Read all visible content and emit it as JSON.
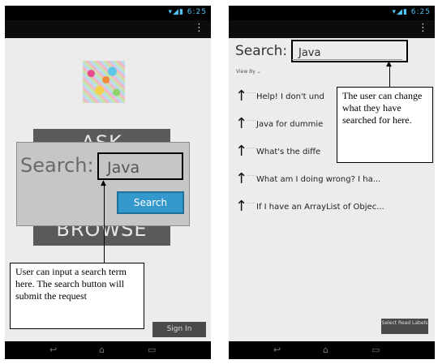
{
  "phone1": {
    "status_time": "6:25",
    "logo_icon": "app-logo-icon",
    "ask_label": "ASK",
    "browse_label": "BROWSE",
    "dialog": {
      "label": "Search:",
      "input_value": "Java",
      "button_label": "Search"
    },
    "signin_label": "Sign In"
  },
  "phone2": {
    "status_time": "6:25",
    "search_label": "Search:",
    "search_value": "Java",
    "viewby_label": "View By",
    "results": [
      {
        "title": "Help! I don't und"
      },
      {
        "title": "Java for dummie"
      },
      {
        "title": "What's the diffe"
      },
      {
        "title": "What am I doing wrong? I ha..."
      },
      {
        "title": "If I have an ArrayList of Objec..."
      }
    ],
    "select_read_label": "Select Read Labels"
  },
  "callouts": {
    "left": "User can input a search term here. The search button will submit the request",
    "right": "The user can change what they have searched for here."
  },
  "colors": {
    "search_button": "#3399cc",
    "status_icons": "#4fc3f7"
  }
}
